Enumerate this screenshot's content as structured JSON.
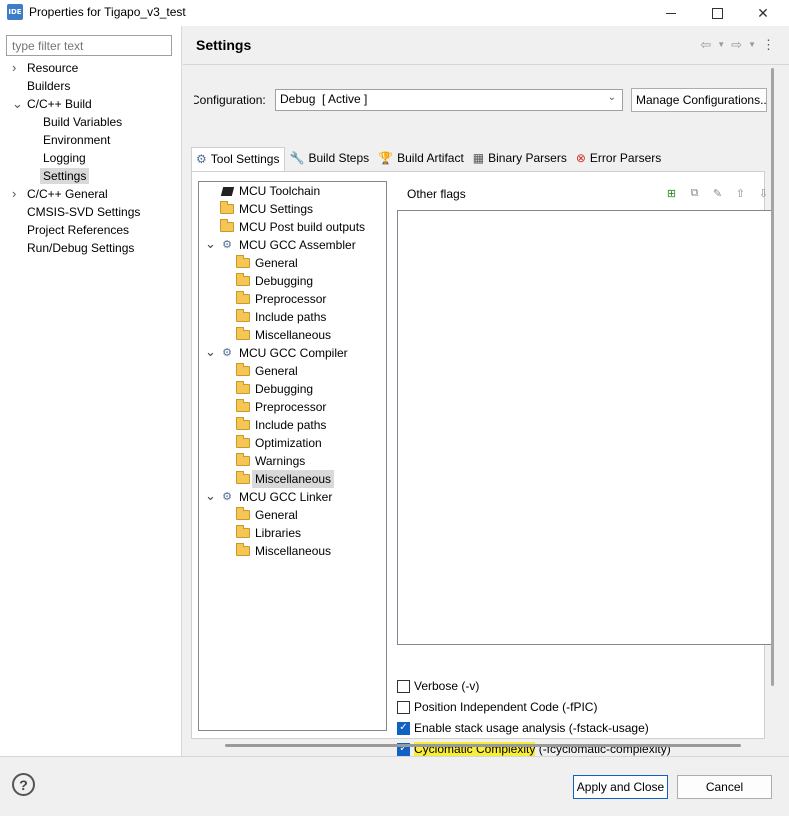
{
  "window": {
    "app_icon_text": "IDE",
    "title": "Properties for Tigapo_v3_test",
    "controls": [
      "minimize",
      "maximize",
      "close"
    ]
  },
  "left_nav": {
    "filter_placeholder": "type filter text",
    "items": [
      {
        "label": "Resource",
        "expandable": true,
        "expanded": false
      },
      {
        "label": "Builders",
        "expandable": false
      },
      {
        "label": "C/C++ Build",
        "expandable": true,
        "expanded": true
      },
      {
        "label": "Build Variables",
        "expandable": false
      },
      {
        "label": "Environment",
        "expandable": false
      },
      {
        "label": "Logging",
        "expandable": false
      },
      {
        "label": "Settings",
        "expandable": false,
        "selected": true
      },
      {
        "label": "C/C++ General",
        "expandable": true,
        "expanded": false
      },
      {
        "label": "CMSIS-SVD Settings",
        "expandable": false
      },
      {
        "label": "Project References",
        "expandable": false
      },
      {
        "label": "Run/Debug Settings",
        "expandable": false
      }
    ]
  },
  "page": {
    "title": "Settings",
    "configuration_label": "Configuration:",
    "configuration_value": "Debug  [ Active ]",
    "manage_button": "Manage Configurations..."
  },
  "tabs": [
    {
      "label": "Tool Settings",
      "icon": "gear-icon",
      "active": true
    },
    {
      "label": "Build Steps",
      "icon": "wrench-icon"
    },
    {
      "label": "Build Artifact",
      "icon": "trophy-icon"
    },
    {
      "label": "Binary Parsers",
      "icon": "binary-icon"
    },
    {
      "label": "Error Parsers",
      "icon": "error-icon"
    }
  ],
  "tool_tree": [
    {
      "label": "MCU Toolchain",
      "icon": "chip-icon"
    },
    {
      "label": "MCU Settings",
      "icon": "folder-icon"
    },
    {
      "label": "MCU Post build outputs",
      "icon": "folder-icon"
    },
    {
      "label": "MCU GCC Assembler",
      "icon": "gear-icon",
      "expandable": true
    },
    {
      "label": "General",
      "icon": "folder-icon"
    },
    {
      "label": "Debugging",
      "icon": "folder-icon"
    },
    {
      "label": "Preprocessor",
      "icon": "folder-icon"
    },
    {
      "label": "Include paths",
      "icon": "folder-icon"
    },
    {
      "label": "Miscellaneous",
      "icon": "folder-icon"
    },
    {
      "label": "MCU GCC Compiler",
      "icon": "gear-icon",
      "expandable": true
    },
    {
      "label": "General",
      "icon": "folder-icon"
    },
    {
      "label": "Debugging",
      "icon": "folder-icon"
    },
    {
      "label": "Preprocessor",
      "icon": "folder-icon"
    },
    {
      "label": "Include paths",
      "icon": "folder-icon"
    },
    {
      "label": "Optimization",
      "icon": "folder-icon"
    },
    {
      "label": "Warnings",
      "icon": "folder-icon"
    },
    {
      "label": "Miscellaneous",
      "icon": "folder-icon",
      "selected": true
    },
    {
      "label": "MCU GCC Linker",
      "icon": "gear-icon",
      "expandable": true
    },
    {
      "label": "General",
      "icon": "folder-icon"
    },
    {
      "label": "Libraries",
      "icon": "folder-icon"
    },
    {
      "label": "Miscellaneous",
      "icon": "folder-icon"
    }
  ],
  "flags": {
    "title": "Other flags",
    "items": []
  },
  "options": [
    {
      "label": "Verbose (-v)",
      "checked": false
    },
    {
      "label": "Position Independent Code (-fPIC)",
      "checked": false
    },
    {
      "label": "Enable stack usage analysis (-fstack-usage)",
      "checked": true
    },
    {
      "label_highlight": "Cyclomatic Complexity",
      "label_rest": " (-fcyclomatic-complexity)",
      "checked": true
    }
  ],
  "footer": {
    "help": "?",
    "apply_close": "Apply and Close",
    "cancel": "Cancel"
  }
}
